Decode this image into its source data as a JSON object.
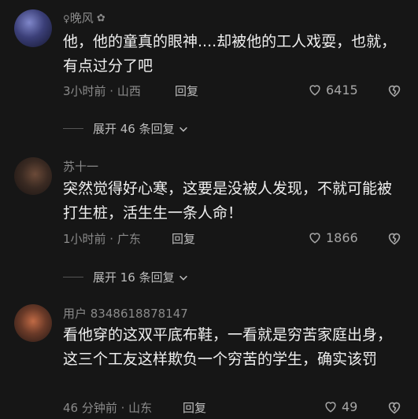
{
  "comments": [
    {
      "username": "晚风",
      "text": "他，他的童真的眼神....却被他的工人戏耍，也就，有点过分了吧",
      "time_location": "3小时前 · 山西",
      "reply_label": "回复",
      "likes": "6415",
      "expand_label": "展开 46 条回复"
    },
    {
      "username": "苏十一",
      "text": "突然觉得好心寒，这要是没被人发现，不就可能被打生桩，活生生一条人命！",
      "time_location": "1小时前 · 广东",
      "reply_label": "回复",
      "likes": "1866",
      "expand_label": "展开 16 条回复"
    },
    {
      "username": "用户 8348618878147",
      "text": "看他穿的这双平底布鞋，一看就是穷苦家庭出身，这三个工友这样欺负一个穷苦的学生，确实该罚",
      "time_location": "46 分钟前 · 山东",
      "reply_label": "回复",
      "likes": "49"
    }
  ],
  "icons": {
    "like": "heart-outline-icon",
    "dislike": "broken-heart-icon",
    "expand": "chevron-down-icon"
  }
}
